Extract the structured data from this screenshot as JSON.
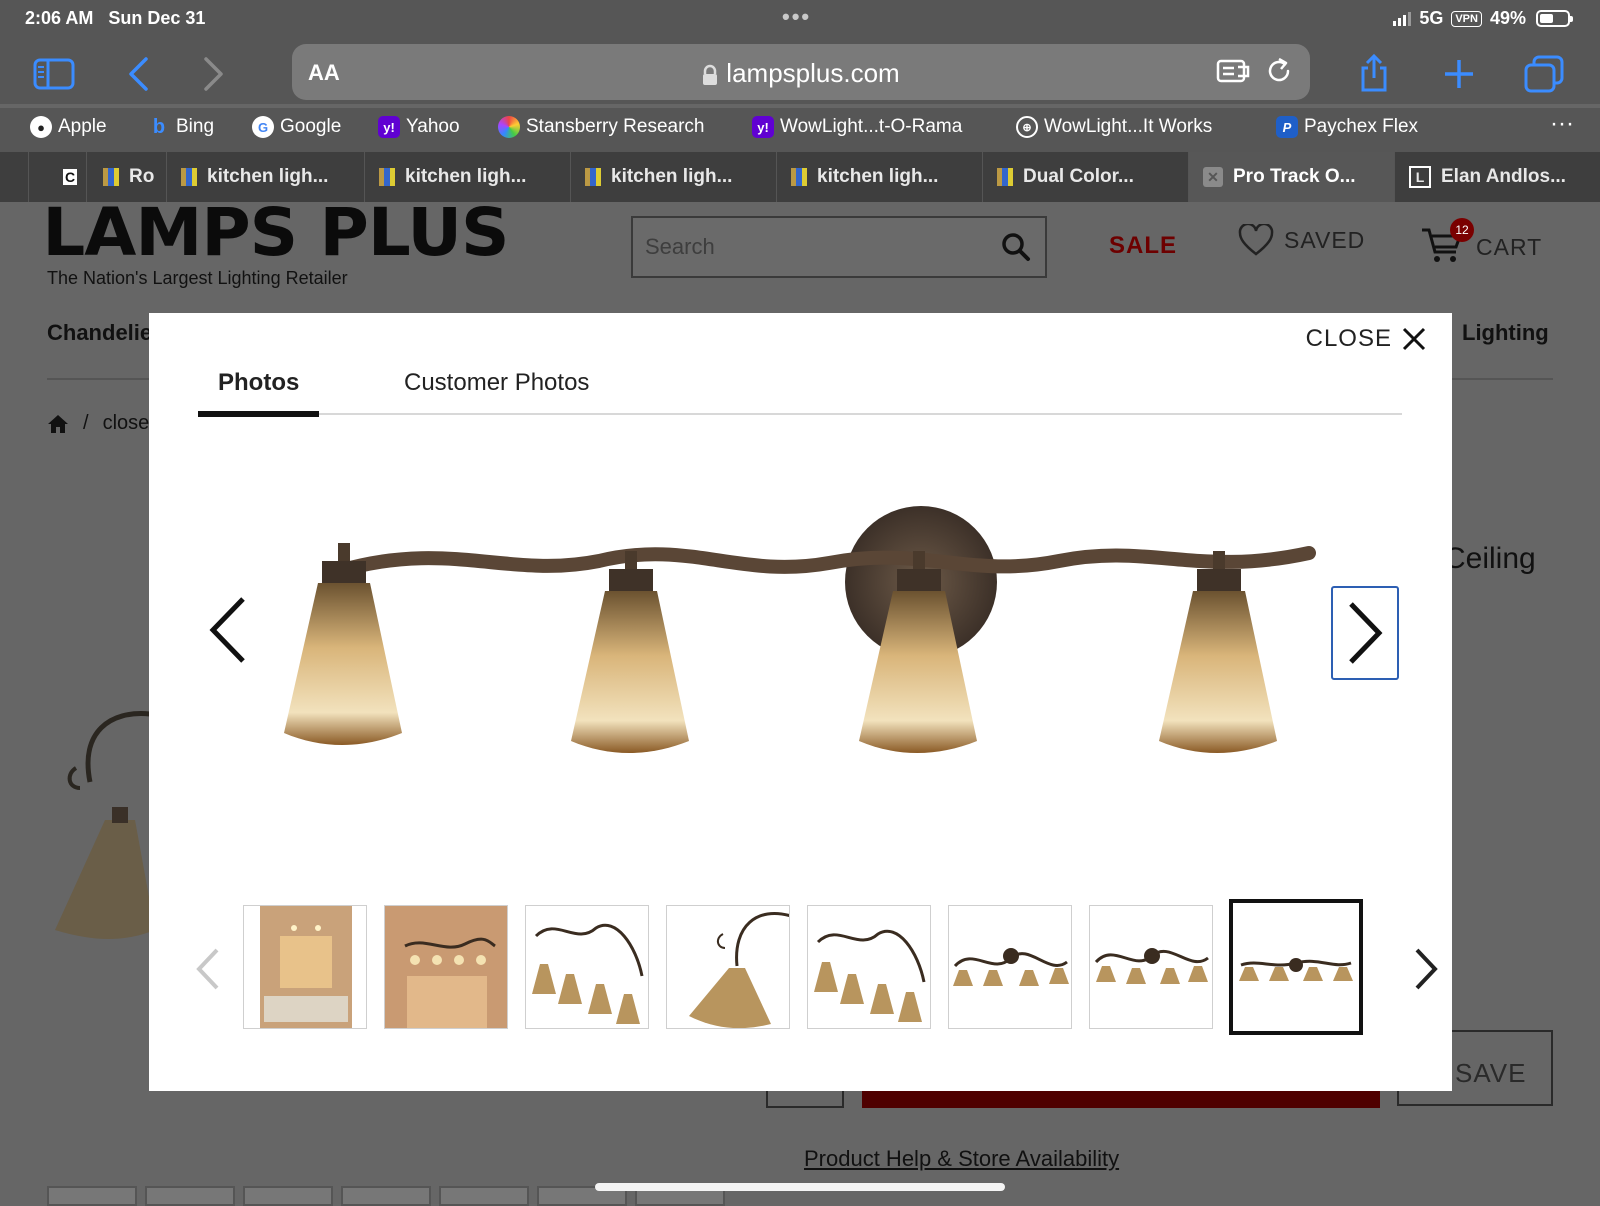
{
  "status": {
    "time": "2:06 AM",
    "date": "Sun Dec 31",
    "network": "5G",
    "vpn": "VPN",
    "battery": "49%"
  },
  "browser": {
    "url_host": "lampsplus.com",
    "text_size_label": "AA"
  },
  "bookmarks": [
    "Apple",
    "Bing",
    "Google",
    "Yahoo",
    "Stansberry Research",
    "WowLight...t-O-Rama",
    "WowLight...It Works",
    "Paychex Flex"
  ],
  "tabs": [
    {
      "label": "C"
    },
    {
      "label": "Ro"
    },
    {
      "label": "kitchen ligh..."
    },
    {
      "label": "kitchen ligh..."
    },
    {
      "label": "kitchen ligh..."
    },
    {
      "label": "kitchen ligh..."
    },
    {
      "label": "Dual Color..."
    },
    {
      "label": "Pro Track O..."
    },
    {
      "label": "Elan Andlos..."
    }
  ],
  "site": {
    "logo": "LAMPS PLUS",
    "tagline": "The Nation's Largest Lighting Retailer",
    "search_placeholder": "Search",
    "sale": "SALE",
    "saved": "SAVED",
    "cart": "CART",
    "cart_count": "12",
    "nav_left": "Chandelie",
    "nav_right": "Lighting",
    "crumb_sep": "/",
    "crumb": "close",
    "title_peek": "Ceiling",
    "save_btn": "SAVE",
    "help_link": "Product Help & Store Availability"
  },
  "modal": {
    "close": "CLOSE",
    "tabs": [
      "Photos",
      "Customer Photos"
    ],
    "active_tab": "Photos",
    "thumbnail_count": 8,
    "selected_thumbnail": 8
  },
  "colors": {
    "accent_blue": "#2d5fb3",
    "sale_red": "#6d0000",
    "ios_blue": "#3b8cff"
  }
}
